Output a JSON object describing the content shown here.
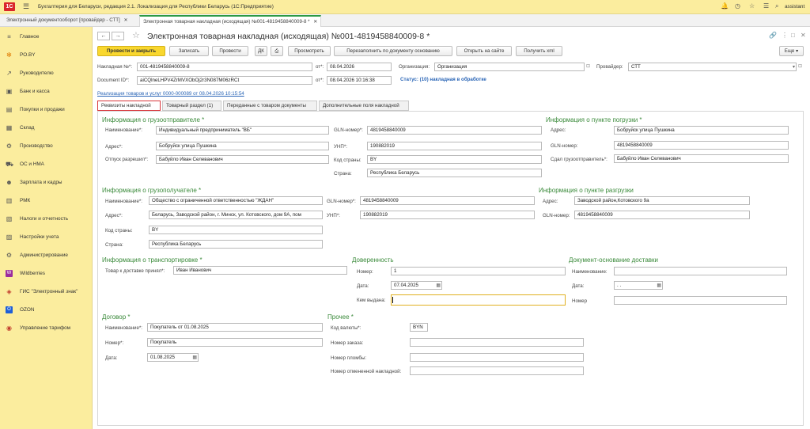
{
  "app": {
    "title": "Бухгалтерия для Беларуси, редакция 2.1. Локализация для Республики Беларусь  (1С:Предприятие)",
    "user": "assistant",
    "logo": "1С"
  },
  "tabs": [
    {
      "label": "Электронный документооборот [провайдер - СТТ]"
    },
    {
      "label": "Электронная товарная накладная (исходящая) №001-4819458840009-8 *"
    }
  ],
  "sidebar": {
    "items": [
      {
        "label": "Главное",
        "icon": "menu-icon"
      },
      {
        "label": "PO.BY",
        "icon": "asterisk-icon"
      },
      {
        "label": "Руководителю",
        "icon": "chart-icon"
      },
      {
        "label": "Банк и касса",
        "icon": "wallet-icon"
      },
      {
        "label": "Покупки и продажи",
        "icon": "cart-icon"
      },
      {
        "label": "Склад",
        "icon": "box-icon"
      },
      {
        "label": "Производство",
        "icon": "factory-icon"
      },
      {
        "label": "ОС и НМА",
        "icon": "car-icon"
      },
      {
        "label": "Зарплата и кадры",
        "icon": "people-icon"
      },
      {
        "label": "РМК",
        "icon": "cashbox-icon"
      },
      {
        "label": "Налоги и отчетность",
        "icon": "tax-icon"
      },
      {
        "label": "Настройки учета",
        "icon": "settings-icon"
      },
      {
        "label": "Администрирование",
        "icon": "gear-icon"
      },
      {
        "label": "Wildberries",
        "icon": "wb-icon"
      },
      {
        "label": "ГИС \"Электронный знак\"",
        "icon": "gis-icon"
      },
      {
        "label": "OZON",
        "icon": "ozon-icon"
      },
      {
        "label": "Управление тарифом",
        "icon": "tariff-icon"
      }
    ]
  },
  "form": {
    "title": "Электронная товарная накладная (исходящая) №001-4819458840009-8 *",
    "toolbar": {
      "post_close": "Провести и закрыть",
      "save": "Записать",
      "post": "Провести",
      "view": "Просмотреть",
      "refill": "Перезаполнить по документу основанию",
      "open_site": "Открыть на сайте",
      "get_xml": "Получить xml",
      "more": "Еще"
    },
    "header": {
      "invoice_no_label": "Накладная №*:",
      "invoice_no": "001-4819458840009-8",
      "from_label": "от*:",
      "from_date": "08.04.2026",
      "org_label": "Организация:",
      "org": "Организация",
      "provider_label": "Провайдер:",
      "provider": "СТТ",
      "docid_label": "Document ID*:",
      "docid": "aiCQlneLHPV4ZrMVXObOj2r3N087M06zRCt",
      "from2_label": "от*:",
      "from2": "08.04.2026 10:16:38",
      "status": "Статус: (10) накладная в обработке",
      "base_link": "Реализация товаров и услуг 0000-000089 от 08.04.2026 10:15:54"
    },
    "ftabs": [
      "Реквизиты накладной",
      "Товарный раздел (1)",
      "Переданные с товаром документы",
      "Дополнительные поля накладной"
    ],
    "shipper": {
      "title": "Информация о грузоотправителе *",
      "name_label": "Наименование*:",
      "name": "Индивидуальный предприниматель \"ВБ\"",
      "addr_label": "Адрес*:",
      "addr": "Бобруйск улица Пушкина",
      "rel_label": "Отпуск разрешил*:",
      "rel": "Бабуйло Иван Селеванович",
      "gln_label": "GLN-номер*:",
      "gln": "4819458840009",
      "unp_label": "УНП*:",
      "unp": "190882019",
      "cc_label": "Код страны:",
      "cc": "BY",
      "country_label": "Страна:",
      "country": "Республика Беларусь"
    },
    "loading": {
      "title": "Информация о пункте погрузки *",
      "addr_label": "Адрес:",
      "addr": "Бобруйск улица Пушкина",
      "gln_label": "GLN-номер:",
      "gln": "4819458840009",
      "handed_label": "Сдал грузоотправитель*:",
      "handed": "Бабуйло Иван Селеванович"
    },
    "consignee": {
      "title": "Информация о грузополучателе *",
      "name_label": "Наименование*:",
      "name": "Общество с ограниченной ответственностью \"ЖДАН\"",
      "addr_label": "Адрес*:",
      "addr": "Беларусь, Заводской район, г. Минск, ул. Котовского, дом 9А, пом",
      "cc_label": "Код страны:",
      "cc": "BY",
      "country_label": "Страна:",
      "country": "Республика Беларусь",
      "gln_label": "GLN-номер*:",
      "gln": "4819458840009",
      "unp_label": "УНП*:",
      "unp": "190882019"
    },
    "unloading": {
      "title": "Информация о пункте разгрузки",
      "addr_label": "Адрес:",
      "addr": "Заводской район,Котовского 9а",
      "gln_label": "GLN-номер:",
      "gln": "4819458840009"
    },
    "transport": {
      "title": "Информация о транспортировке *",
      "accepted_label": "Товар к доставке принял*:",
      "accepted": "Иван Иванович"
    },
    "poa": {
      "title": "Доверенность",
      "num_label": "Номер:",
      "num": "1",
      "date_label": "Дата:",
      "date": "07.04.2025",
      "issued_label": "Кем выдана:",
      "issued": ""
    },
    "basedoc": {
      "title": "Документ-основание доставки",
      "name_label": "Наименование:",
      "name": "",
      "date_label": "Дата:",
      "date": " .  .    ",
      "num_label": "Номер",
      "num": ""
    },
    "contract": {
      "title": "Договор *",
      "name_label": "Наименование*:",
      "name": "Покупатель  от 01.08.2025",
      "num_label": "Номер*:",
      "num": "Покупатель",
      "date_label": "Дата:",
      "date": "01.08.2025"
    },
    "other": {
      "title": "Прочее *",
      "cur_label": "Код валюты*:",
      "cur": "BYN",
      "order_label": "Номер заказа:",
      "order": "",
      "seal_label": "Номер пломбы:",
      "seal": "",
      "cancel_label": "Номер отмененной накладной:",
      "cancel": ""
    }
  }
}
